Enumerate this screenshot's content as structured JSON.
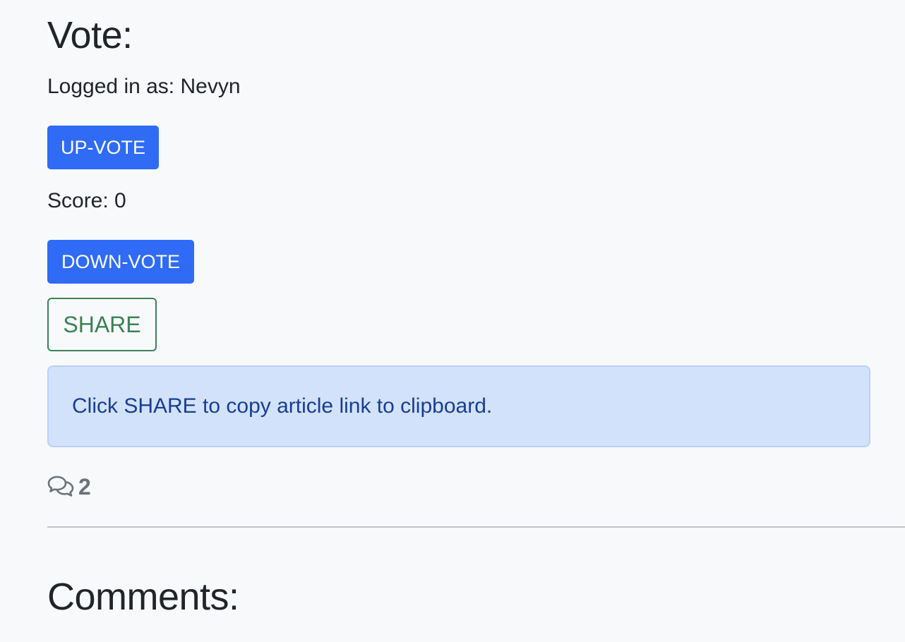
{
  "vote": {
    "heading": "Vote:",
    "logged_in": "Logged in as: Nevyn",
    "upvote_label": "UP-VOTE",
    "score": "Score: 0",
    "downvote_label": "DOWN-VOTE",
    "share_label": "SHARE"
  },
  "alert": {
    "message": "Click SHARE to copy article link to clipboard."
  },
  "comments": {
    "icon": "comments-icon",
    "count": "2",
    "heading": "Comments:"
  },
  "colors": {
    "primary": "#2f6bf5",
    "success": "#3a8256",
    "info_bg": "#d3e2fb",
    "info_text": "#173e93",
    "muted": "#6b7279"
  }
}
